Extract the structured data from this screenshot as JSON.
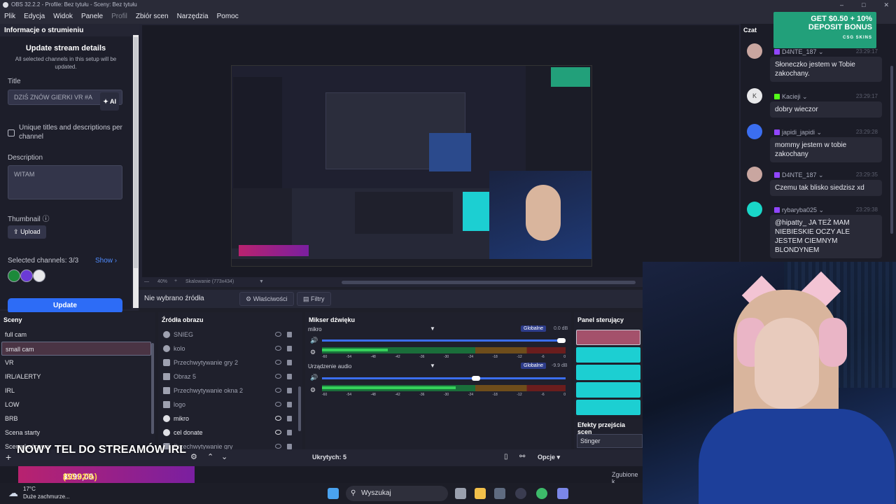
{
  "titlebar": {
    "text": "OBS 32.2.2 - Profile: Bez tytułu - Sceny: Bez tytułu"
  },
  "menu": [
    "Plik",
    "Edycja",
    "Widok",
    "Panele",
    "Profil",
    "Zbiór scen",
    "Narzędzia",
    "Pomoc"
  ],
  "stream_info": {
    "dock_title": "Informacje o strumieniu",
    "heading": "Update stream details",
    "subtitle": "All selected channels in this setup will be updated.",
    "title_label": "Title",
    "title_value": "DZIŚ ZNÓW GIERKI VR #A",
    "ai_label": "AI",
    "unique_label": "Unique titles and descriptions per channel",
    "description_label": "Description",
    "description_value": "WITAM",
    "thumbnail_label": "Thumbnail",
    "upload_label": "Upload",
    "selected_channels": "Selected channels: 3/3",
    "show_label": "Show",
    "update_label": "Update"
  },
  "preview": {
    "zoom": "40%",
    "scaling": "Skalowanie (773x434)",
    "no_source": "Nie wybrano źródła",
    "properties": "Właściwości",
    "filters": "Filtry"
  },
  "scenes": {
    "title": "Sceny",
    "items": [
      "full cam",
      "small cam",
      "VR",
      "IRL/ALERTY",
      "IRL",
      "LOW",
      "BRB",
      "Scena starty",
      "Scena końcowa"
    ],
    "selected": "small cam"
  },
  "sources": {
    "title": "Źródła obrazu",
    "items": [
      "SNIEG",
      "kolo",
      "Przechwytywanie gry 2",
      "Obraz 5",
      "Przechwytywanie okna 2",
      "logo",
      "mikro",
      "cel donate",
      "Przechwytywanie gry"
    ]
  },
  "mixer": {
    "title": "Mikser dźwięku",
    "channels": [
      {
        "name": "mikro",
        "badge": "Globalne",
        "db": "0.0 dB",
        "volume": 1.0,
        "level": 0.27
      },
      {
        "name": "Urządzenie audio",
        "badge": "Globalne",
        "db": "-9.9 dB",
        "volume": 0.65,
        "level": 0.55
      }
    ],
    "scale": [
      "-60",
      "-54",
      "-48",
      "-42",
      "-36",
      "-30",
      "-24",
      "-18",
      "-12",
      "-6",
      "0"
    ],
    "hidden": "Ukrytych: 5",
    "options": "Opcje"
  },
  "control_panel": {
    "title": "Panel sterujący"
  },
  "transitions": {
    "title": "Efekty przejścia scen",
    "value": "Stinger"
  },
  "status": {
    "dropped": "Zgubione k"
  },
  "chat": {
    "title": "Czat",
    "messages": [
      {
        "user": "D4NTE_187",
        "time": "23:29:17",
        "text": "Słoneczko jestem w Tobie zakochany.",
        "platform_color": "#9146ff",
        "avatar_color": "#c9a6a0"
      },
      {
        "user": "Kacieji",
        "time": "23:29:17",
        "text": "dobry wieczor",
        "platform_color": "#53fc18",
        "avatar_color": "#e8e8ea",
        "avatar_letter": "K"
      },
      {
        "user": "japidi_japidi",
        "time": "23:29:28",
        "text": "mommy jestem w tobie zakochany",
        "platform_color": "#9146ff",
        "avatar_color": "#3b6ef0"
      },
      {
        "user": "D4NTE_187",
        "time": "23:29:35",
        "text": "Czemu tak blisko siedzisz xd",
        "platform_color": "#9146ff",
        "avatar_color": "#c9a6a0"
      },
      {
        "user": "rybaryba025",
        "time": "23:29:38",
        "text": "@hipatty_ JA TEŻ MAM NIEBIESKIE OCZY ALE JESTEM CIEMNYM BLONDYNEM",
        "platform_color": "#9146ff",
        "avatar_color": "#19d6c8"
      }
    ]
  },
  "ad": {
    "line1": "GET $0.50 + 10%",
    "line2": "DEPOSIT BONUS",
    "brand": "CSG SKINS"
  },
  "overlay": {
    "ticker": "NOWY TEL DO STREAMÓW IRL",
    "raised": "1 200,40 zł",
    "sep": "z",
    "goal": "3999,00 zł",
    "percent": "(30.02%)"
  },
  "taskbar": {
    "temp": "17°C",
    "weather": "Duże zachmurze...",
    "search": "Wyszukaj"
  }
}
